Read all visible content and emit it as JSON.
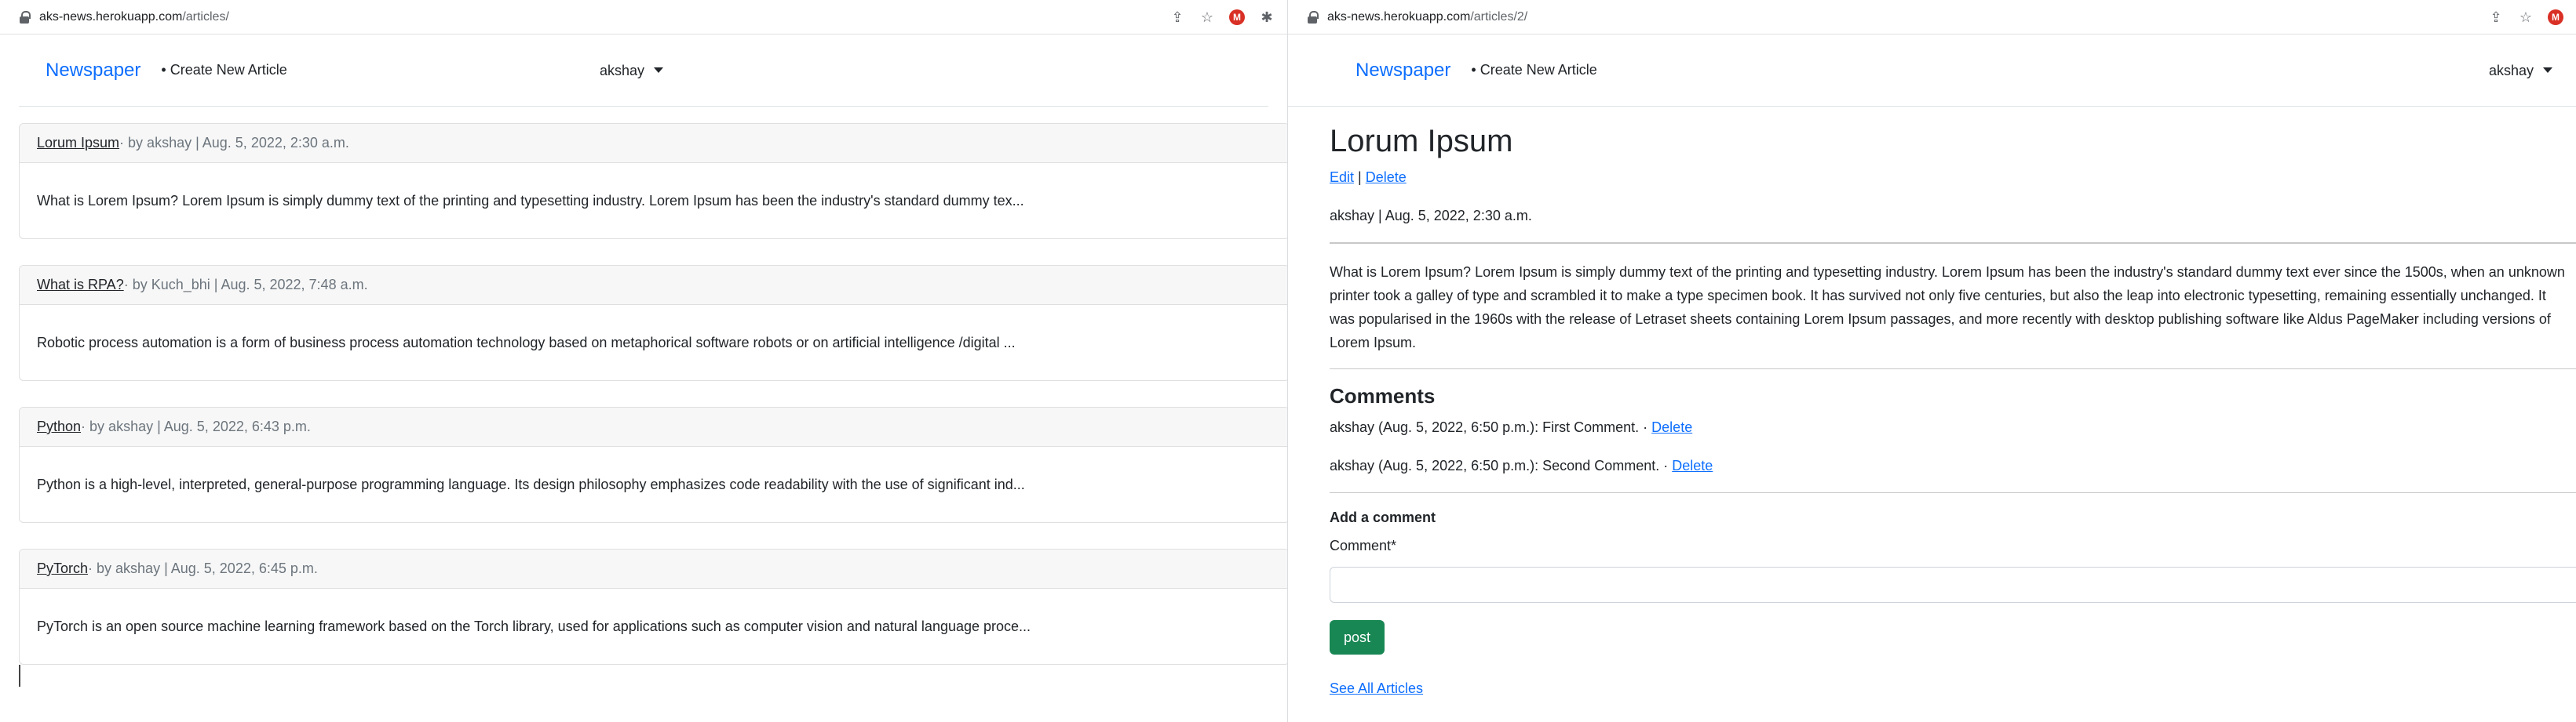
{
  "left": {
    "url_host": "aks-news.herokuapp.com",
    "url_path": "/articles/",
    "navbar": {
      "brand": "Newspaper",
      "create_link": "Create New Article",
      "user": "akshay"
    },
    "articles": [
      {
        "title": "Lorum Ipsum",
        "byline": " · by akshay | Aug. 5, 2022, 2:30 a.m.",
        "excerpt": "What is Lorem Ipsum? Lorem Ipsum is simply dummy text of the printing and typesetting industry. Lorem Ipsum has been the industry's standard dummy tex..."
      },
      {
        "title": "What is RPA?",
        "byline": " · by Kuch_bhi | Aug. 5, 2022, 7:48 a.m.",
        "excerpt": "Robotic process automation is a form of business process automation technology based on metaphorical software robots or on artificial intelligence /digital ..."
      },
      {
        "title": "Python",
        "byline": " · by akshay | Aug. 5, 2022, 6:43 p.m.",
        "excerpt": "Python is a high-level, interpreted, general-purpose programming language. Its design philosophy emphasizes code readability with the use of significant ind..."
      },
      {
        "title": "PyTorch",
        "byline": " · by akshay | Aug. 5, 2022, 6:45 p.m.",
        "excerpt": "PyTorch is an open source machine learning framework based on the Torch library, used for applications such as computer vision and natural language proce..."
      }
    ]
  },
  "right": {
    "url_host": "aks-news.herokuapp.com",
    "url_path": "/articles/2/",
    "navbar": {
      "brand": "Newspaper",
      "create_link": "Create New Article",
      "user": "akshay"
    },
    "article": {
      "title": "Lorum Ipsum",
      "edit_label": "Edit",
      "separator": " | ",
      "delete_label": "Delete",
      "meta": "akshay | Aug. 5, 2022, 2:30 a.m.",
      "body": "What is Lorem Ipsum? Lorem Ipsum is simply dummy text of the printing and typesetting industry. Lorem Ipsum has been the industry's standard dummy text ever since the 1500s, when an unknown printer took a galley of type and scrambled it to make a type specimen book. It has survived not only five centuries, but also the leap into electronic typesetting, remaining essentially unchanged. It was popularised in the 1960s with the release of Letraset sheets containing Lorem Ipsum passages, and more recently with desktop publishing software like Aldus PageMaker including versions of Lorem Ipsum."
    },
    "comments_heading": "Comments",
    "comments": [
      {
        "text": "akshay (Aug. 5, 2022, 6:50 p.m.): First Comment. · ",
        "delete_label": "Delete"
      },
      {
        "text": "akshay (Aug. 5, 2022, 6:50 p.m.): Second Comment. · ",
        "delete_label": "Delete"
      }
    ],
    "add_comment": {
      "heading": "Add a comment",
      "label": "Comment*",
      "value": "",
      "post_label": "post"
    },
    "see_all_label": "See All Articles"
  },
  "colors": {
    "link": "#0d6efd",
    "post_button": "#198754",
    "ext_icon": "#d93025"
  },
  "icons": [
    "lock-icon",
    "share-icon",
    "star-icon",
    "extension-icon",
    "puzzle-icon",
    "caret-down-icon"
  ]
}
